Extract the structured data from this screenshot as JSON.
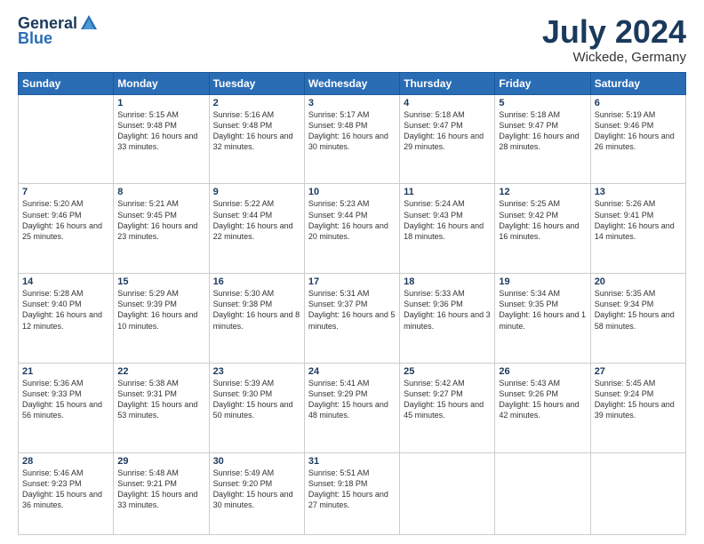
{
  "header": {
    "logo_general": "General",
    "logo_blue": "Blue",
    "main_title": "July 2024",
    "subtitle": "Wickede, Germany"
  },
  "columns": [
    "Sunday",
    "Monday",
    "Tuesday",
    "Wednesday",
    "Thursday",
    "Friday",
    "Saturday"
  ],
  "weeks": [
    [
      {
        "day": "",
        "sunrise": "",
        "sunset": "",
        "daylight": ""
      },
      {
        "day": "1",
        "sunrise": "Sunrise: 5:15 AM",
        "sunset": "Sunset: 9:48 PM",
        "daylight": "Daylight: 16 hours and 33 minutes."
      },
      {
        "day": "2",
        "sunrise": "Sunrise: 5:16 AM",
        "sunset": "Sunset: 9:48 PM",
        "daylight": "Daylight: 16 hours and 32 minutes."
      },
      {
        "day": "3",
        "sunrise": "Sunrise: 5:17 AM",
        "sunset": "Sunset: 9:48 PM",
        "daylight": "Daylight: 16 hours and 30 minutes."
      },
      {
        "day": "4",
        "sunrise": "Sunrise: 5:18 AM",
        "sunset": "Sunset: 9:47 PM",
        "daylight": "Daylight: 16 hours and 29 minutes."
      },
      {
        "day": "5",
        "sunrise": "Sunrise: 5:18 AM",
        "sunset": "Sunset: 9:47 PM",
        "daylight": "Daylight: 16 hours and 28 minutes."
      },
      {
        "day": "6",
        "sunrise": "Sunrise: 5:19 AM",
        "sunset": "Sunset: 9:46 PM",
        "daylight": "Daylight: 16 hours and 26 minutes."
      }
    ],
    [
      {
        "day": "7",
        "sunrise": "Sunrise: 5:20 AM",
        "sunset": "Sunset: 9:46 PM",
        "daylight": "Daylight: 16 hours and 25 minutes."
      },
      {
        "day": "8",
        "sunrise": "Sunrise: 5:21 AM",
        "sunset": "Sunset: 9:45 PM",
        "daylight": "Daylight: 16 hours and 23 minutes."
      },
      {
        "day": "9",
        "sunrise": "Sunrise: 5:22 AM",
        "sunset": "Sunset: 9:44 PM",
        "daylight": "Daylight: 16 hours and 22 minutes."
      },
      {
        "day": "10",
        "sunrise": "Sunrise: 5:23 AM",
        "sunset": "Sunset: 9:44 PM",
        "daylight": "Daylight: 16 hours and 20 minutes."
      },
      {
        "day": "11",
        "sunrise": "Sunrise: 5:24 AM",
        "sunset": "Sunset: 9:43 PM",
        "daylight": "Daylight: 16 hours and 18 minutes."
      },
      {
        "day": "12",
        "sunrise": "Sunrise: 5:25 AM",
        "sunset": "Sunset: 9:42 PM",
        "daylight": "Daylight: 16 hours and 16 minutes."
      },
      {
        "day": "13",
        "sunrise": "Sunrise: 5:26 AM",
        "sunset": "Sunset: 9:41 PM",
        "daylight": "Daylight: 16 hours and 14 minutes."
      }
    ],
    [
      {
        "day": "14",
        "sunrise": "Sunrise: 5:28 AM",
        "sunset": "Sunset: 9:40 PM",
        "daylight": "Daylight: 16 hours and 12 minutes."
      },
      {
        "day": "15",
        "sunrise": "Sunrise: 5:29 AM",
        "sunset": "Sunset: 9:39 PM",
        "daylight": "Daylight: 16 hours and 10 minutes."
      },
      {
        "day": "16",
        "sunrise": "Sunrise: 5:30 AM",
        "sunset": "Sunset: 9:38 PM",
        "daylight": "Daylight: 16 hours and 8 minutes."
      },
      {
        "day": "17",
        "sunrise": "Sunrise: 5:31 AM",
        "sunset": "Sunset: 9:37 PM",
        "daylight": "Daylight: 16 hours and 5 minutes."
      },
      {
        "day": "18",
        "sunrise": "Sunrise: 5:33 AM",
        "sunset": "Sunset: 9:36 PM",
        "daylight": "Daylight: 16 hours and 3 minutes."
      },
      {
        "day": "19",
        "sunrise": "Sunrise: 5:34 AM",
        "sunset": "Sunset: 9:35 PM",
        "daylight": "Daylight: 16 hours and 1 minute."
      },
      {
        "day": "20",
        "sunrise": "Sunrise: 5:35 AM",
        "sunset": "Sunset: 9:34 PM",
        "daylight": "Daylight: 15 hours and 58 minutes."
      }
    ],
    [
      {
        "day": "21",
        "sunrise": "Sunrise: 5:36 AM",
        "sunset": "Sunset: 9:33 PM",
        "daylight": "Daylight: 15 hours and 56 minutes."
      },
      {
        "day": "22",
        "sunrise": "Sunrise: 5:38 AM",
        "sunset": "Sunset: 9:31 PM",
        "daylight": "Daylight: 15 hours and 53 minutes."
      },
      {
        "day": "23",
        "sunrise": "Sunrise: 5:39 AM",
        "sunset": "Sunset: 9:30 PM",
        "daylight": "Daylight: 15 hours and 50 minutes."
      },
      {
        "day": "24",
        "sunrise": "Sunrise: 5:41 AM",
        "sunset": "Sunset: 9:29 PM",
        "daylight": "Daylight: 15 hours and 48 minutes."
      },
      {
        "day": "25",
        "sunrise": "Sunrise: 5:42 AM",
        "sunset": "Sunset: 9:27 PM",
        "daylight": "Daylight: 15 hours and 45 minutes."
      },
      {
        "day": "26",
        "sunrise": "Sunrise: 5:43 AM",
        "sunset": "Sunset: 9:26 PM",
        "daylight": "Daylight: 15 hours and 42 minutes."
      },
      {
        "day": "27",
        "sunrise": "Sunrise: 5:45 AM",
        "sunset": "Sunset: 9:24 PM",
        "daylight": "Daylight: 15 hours and 39 minutes."
      }
    ],
    [
      {
        "day": "28",
        "sunrise": "Sunrise: 5:46 AM",
        "sunset": "Sunset: 9:23 PM",
        "daylight": "Daylight: 15 hours and 36 minutes."
      },
      {
        "day": "29",
        "sunrise": "Sunrise: 5:48 AM",
        "sunset": "Sunset: 9:21 PM",
        "daylight": "Daylight: 15 hours and 33 minutes."
      },
      {
        "day": "30",
        "sunrise": "Sunrise: 5:49 AM",
        "sunset": "Sunset: 9:20 PM",
        "daylight": "Daylight: 15 hours and 30 minutes."
      },
      {
        "day": "31",
        "sunrise": "Sunrise: 5:51 AM",
        "sunset": "Sunset: 9:18 PM",
        "daylight": "Daylight: 15 hours and 27 minutes."
      },
      {
        "day": "",
        "sunrise": "",
        "sunset": "",
        "daylight": ""
      },
      {
        "day": "",
        "sunrise": "",
        "sunset": "",
        "daylight": ""
      },
      {
        "day": "",
        "sunrise": "",
        "sunset": "",
        "daylight": ""
      }
    ]
  ]
}
